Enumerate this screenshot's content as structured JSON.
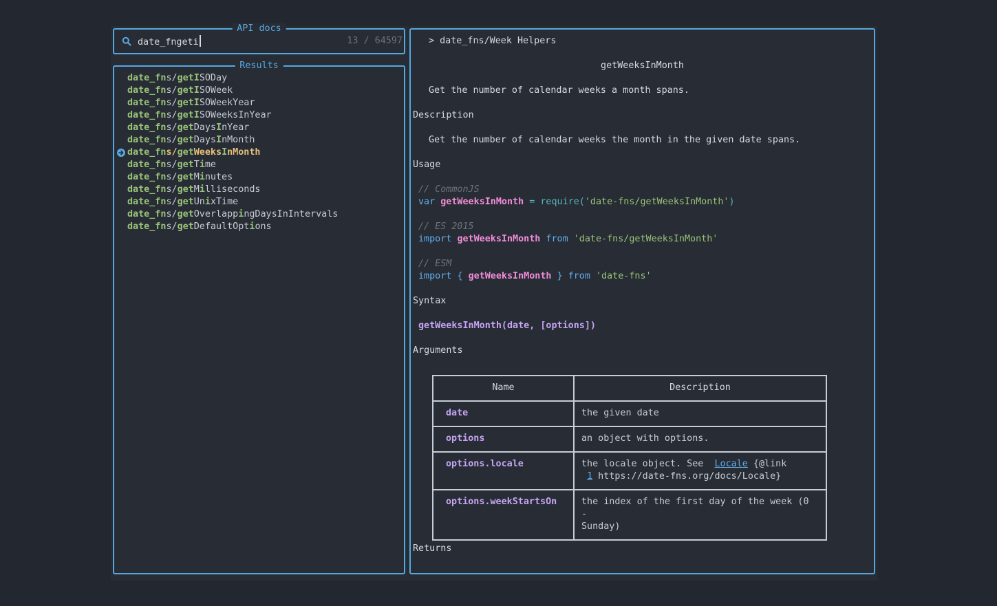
{
  "search": {
    "title": "API docs",
    "query": "date_fngeti",
    "count": "13 / 64597"
  },
  "results": {
    "title": "Results",
    "items": [
      [
        "date_fn",
        "s/",
        "getI",
        "SODay"
      ],
      [
        "date_fn",
        "s/",
        "getI",
        "SOWeek"
      ],
      [
        "date_fn",
        "s/",
        "getI",
        "SOWeekYear"
      ],
      [
        "date_fn",
        "s/",
        "getI",
        "SOWeeksInYear"
      ]
    ],
    "selected_index": 6
  },
  "preview": {
    "breadcrumb": "> date_fns/Week Helpers",
    "title": "getWeeksInMonth",
    "summary": "Get the number of calendar weeks a month spans.",
    "description_heading": "Description",
    "description": "Get the number of calendar weeks the month in the given date spans.",
    "usage_heading": "Usage",
    "comment_commonjs": "// CommonJS",
    "code_var": "var",
    "code_fn": "getWeeksInMonth",
    "code_eq": "=",
    "code_require": "require(",
    "code_str1": "'date-fns/getWeeksInMonth'",
    "code_close": ")",
    "comment_es": "// ES 2015",
    "code_import": "import",
    "code_from": "from",
    "comment_esm": "// ESM",
    "code_open_brace": "{",
    "code_close_brace": "}",
    "code_str2": "'date-fns'",
    "syntax_heading": "Syntax",
    "syntax": "getWeeksInMonth(date, [options])",
    "arguments_heading": "Arguments",
    "table": {
      "headers": [
        "Name",
        "Description"
      ],
      "rows": [
        {
          "name": "date",
          "desc": "the given date"
        },
        {
          "name": "options",
          "desc": "an object with options."
        },
        {
          "name": "options.locale",
          "desc_pre": "the locale object. See  ",
          "desc_link": "Locale",
          "desc_mid": " {@link",
          "desc_link2": "1",
          "desc_post": " https://date-fns.org/docs/Locale}"
        },
        {
          "name": "options.weekStartsOn",
          "desc": "the index of the first day of the week (0 -",
          "desc2": "Sunday)"
        }
      ]
    },
    "returns_heading": "Returns"
  },
  "colors": {
    "border": "#56a8e0",
    "match": "#98c379",
    "selected": "#e5c07b",
    "purple": "#c5a5f5"
  }
}
